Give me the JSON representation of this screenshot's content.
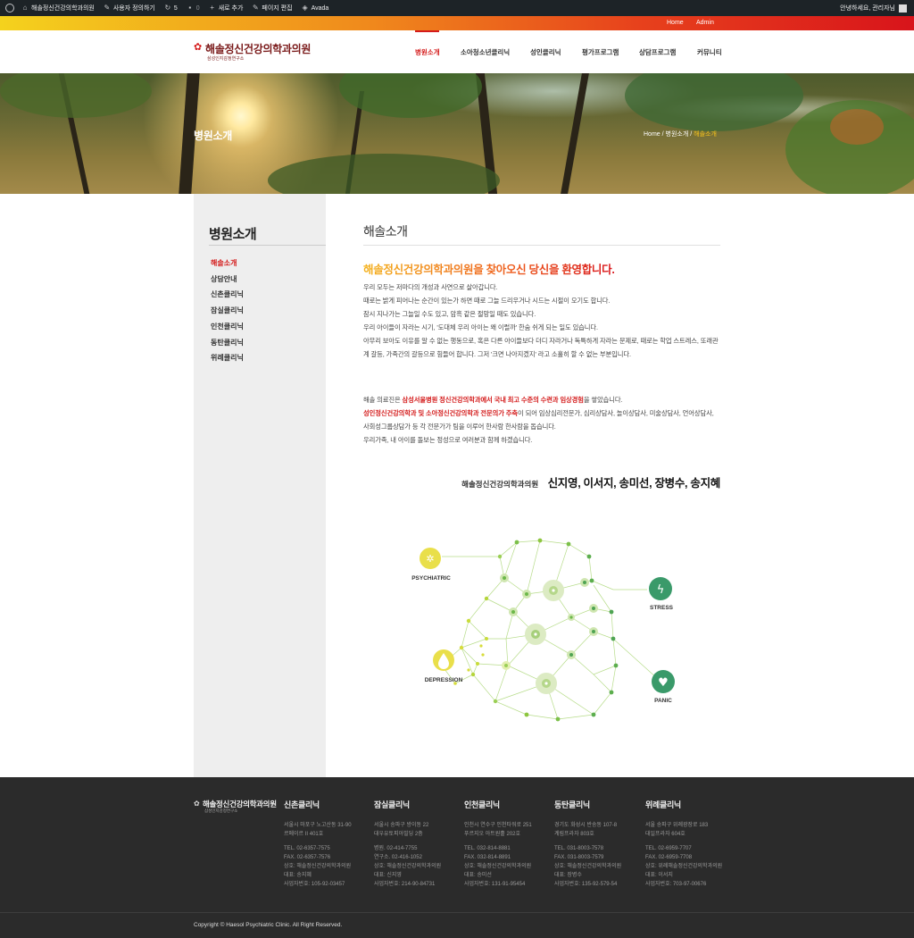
{
  "admin_bar": {
    "site_name": "해솔정신건강의학과의원",
    "customize": "사용자 정의하기",
    "updates_count": "5",
    "comments_count": "0",
    "new": "새로 추가",
    "edit_page": "페이지 편집",
    "avada": "Avada",
    "greeting": "안녕하세요, 관리자님"
  },
  "top_links": {
    "home": "Home",
    "admin": "Admin"
  },
  "logo": {
    "name": "해솔정신건강의학과의원",
    "sub": "삼성인지감정연구소"
  },
  "nav": {
    "items": [
      "병원소개",
      "소아청소년클리닉",
      "성인클리닉",
      "평가프로그램",
      "상담프로그램",
      "커뮤니티"
    ],
    "active": "병원소개"
  },
  "hero": {
    "title": "병원소개",
    "breadcrumb": {
      "home": "Home",
      "sep": "/",
      "parent": "병원소개",
      "current": "해솔소개"
    }
  },
  "sidebar": {
    "title": "병원소개",
    "items": [
      "해솔소개",
      "상담안내",
      "신촌클리닉",
      "잠실클리닉",
      "인천클리닉",
      "동탄클리닉",
      "위례클리닉"
    ]
  },
  "main": {
    "title": "해솔소개",
    "welcome": "해솔정신건강의학과의원을 찾아오신 당신을 환영합니다.",
    "para1": [
      "우리 모두는 저마다의 개성과 사연으로 살아갑니다.",
      "때로는 밝게 피어나는 순간이 있는가 하면 때로 그늘 드리우거나 시드는 시절이 오기도 합니다.",
      "잠시 지나가는 그늘일 수도 있고, 암흑 같은 절망일 때도 있습니다.",
      "우리 아이들이 자라는 시기, '도대체 우리 아이는 왜 이럴까' 한숨 쉬게 되는 일도 있습니다.",
      "아무리 보아도 이유를 알 수 없는 행동으로, 혹은 다른 아이들보다 더디 자라거나 독특하게 자라는 문제로, 때로는 학업 스트레스, 또래관계 갈등, 가족간의 갈등으로 힘들어 합니다. 그저 '크면 나아지겠지' 라고 소홀히 할 수 없는 부분입니다."
    ],
    "para2": {
      "l1_pre": "해솔 의료진은 ",
      "l1_red": "삼성서울병원 정신건강의학과에서 국내 최고 수준의 수련과 임상경험",
      "l1_post": "을 쌓았습니다.",
      "l2_red": "성인정신건강의학과 및 소아정신건강의학과 전문의가 주축",
      "l2_post": "이 되어 임상심리전문가, 심리상담사, 놀이상담사, 미술상담사, 언어상담사, 사회성그룹상담가 등 각 전문가가 팀을 이루어 한사람 한사람을 돕습니다.",
      "l3": "우리가족, 내 아이를 돌보는 정성으로 여러분과 함께 하겠습니다."
    },
    "doctors_clinic": "해솔정신건강의학과의원",
    "doctors_names": "신지영, 이서지, 송미선, 장병수, 송지혜"
  },
  "diagram": {
    "labels": [
      "PSYCHIATRIC",
      "STRESS",
      "DEPRESSION",
      "PANIC"
    ],
    "colors": {
      "yellow": "#e9df4a",
      "green": "#3a9a6a",
      "light_green": "#8dc63f",
      "dark_green": "#5cae4e"
    }
  },
  "footer": {
    "logo_name": "해솔정신건강의학과의원",
    "logo_sub": "삼성인지감정연구소",
    "clinics": [
      {
        "name": "신촌클리닉",
        "addr": [
          "서울시 마포구 노고산동 31-90",
          "르메이르 II 401호"
        ],
        "info": [
          "TEL. 02-6357-7575",
          "FAX. 02-6357-7576",
          "상호: 해솔정신건강의학과의원",
          "대표: 송지혜",
          "사업자번호: 105-92-03457"
        ]
      },
      {
        "name": "잠실클리닉",
        "addr": [
          "서울시 송파구 방이동 22",
          "대우유토피아빌딩 2층"
        ],
        "info": [
          "병원. 02-414-7755",
          "연구소. 02-416-1052",
          "상호: 해솔정신건강의학과의원",
          "대표: 신지영",
          "사업자번호: 214-90-84731"
        ]
      },
      {
        "name": "인천클리닉",
        "addr": [
          "인천시 연수구 인천타워로 251",
          "푸르지오 아트원홀 202호"
        ],
        "info": [
          "TEL. 032-814-8881",
          "FAX. 032-814-8891",
          "상호: 해솔정신건강의학과의원",
          "대표: 송미선",
          "사업자번호: 131-91-95454"
        ]
      },
      {
        "name": "동탄클리닉",
        "addr": [
          "경기도 화성시 반송동 107-8",
          "계림프라자 803호"
        ],
        "info": [
          "TEL. 031-8003-7578",
          "FAX. 031-8003-7579",
          "상호: 해솔정신건강의학과의원",
          "대표: 장병수",
          "사업자번호: 135-92-579-54"
        ]
      },
      {
        "name": "위례클리닉",
        "addr": [
          "서울 송파구 위례광장로 183",
          "대일프라자 604호"
        ],
        "info": [
          "TEL. 02-6959-7707",
          "FAX. 02-6959-7708",
          "상호: 위례해솔정신건강의학과의원",
          "대표: 이서지",
          "사업자번호: 703-97-00676"
        ]
      }
    ],
    "copyright": "Copyright © Haesol Psychiatric Clinic. All Right Reserved."
  }
}
